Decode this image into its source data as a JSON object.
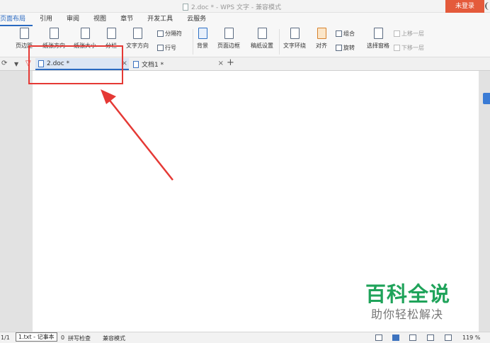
{
  "titlebar": {
    "title": "2.doc * - WPS 文字 - 兼容模式",
    "login": "未登录"
  },
  "menu": {
    "tabs": [
      "页面布局",
      "引用",
      "审阅",
      "视图",
      "章节",
      "开发工具",
      "云服务"
    ],
    "active": "页面布局"
  },
  "ribbon": {
    "margins": "页边距",
    "orientation": "纸张方向",
    "size": "纸张大小",
    "columns": "分栏",
    "text_direction": "文字方向",
    "separator": "分隔符",
    "line_numbers": "行号",
    "background": "背景",
    "page_border": "页面边框",
    "draft_settings": "稿纸设置",
    "text_wrap": "文字环绕",
    "align": "对齐",
    "group": "组合",
    "rotate": "旋转",
    "selection_pane": "选择窗格",
    "bring_forward": "上移一层",
    "send_backward": "下移一层"
  },
  "tabs": {
    "active_doc": "2.doc *",
    "second_doc": "文档1 *",
    "close": "×",
    "new": "+"
  },
  "watermark": {
    "main": "百科全说",
    "sub": "助你轻松解决"
  },
  "status": {
    "page": "1/1",
    "tooltip": "1.txt - 记事本",
    "count": "0",
    "spellcheck": "拼写检查",
    "compat": "兼容模式",
    "zoom": "119 %"
  },
  "colors": {
    "accent": "#2a6ac1",
    "login_bg": "#e45a3b",
    "annotation": "#e53935",
    "watermark": "#1fa35a"
  }
}
